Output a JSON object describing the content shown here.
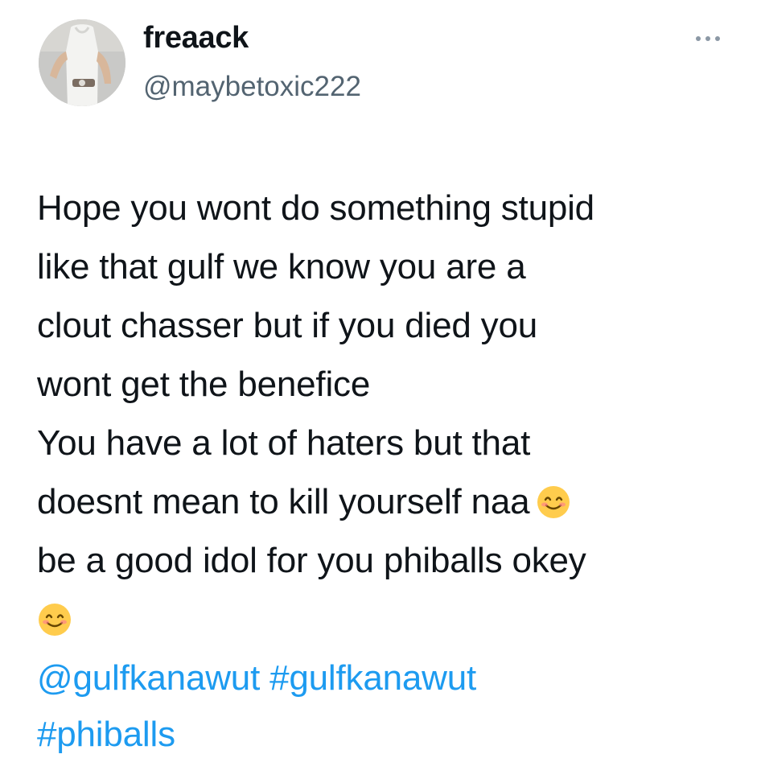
{
  "tweet": {
    "author": {
      "display_name": "freaack",
      "handle": "@maybetoxic222",
      "avatar_icon": "profile-photo"
    },
    "more_icon": "more-options-icon",
    "body_lines": [
      "Hope you wont do something stupid",
      "like that gulf we know you are a",
      "clout chasser but if you died you",
      "wont get the benefice",
      "You have a lot of haters but that",
      "doesnt mean to kill yourself naa",
      "be a good idol for you phiballs okey"
    ],
    "emoji_name": "smiling-face-with-smiling-eyes",
    "mentions": {
      "mention": "@gulfkanawut",
      "hashtag_1": "#gulfkanawut",
      "hashtag_2": "#phiballs"
    },
    "colors": {
      "text": "#0f1419",
      "secondary": "#536471",
      "link": "#1d9bf0",
      "background": "#ffffff"
    }
  }
}
